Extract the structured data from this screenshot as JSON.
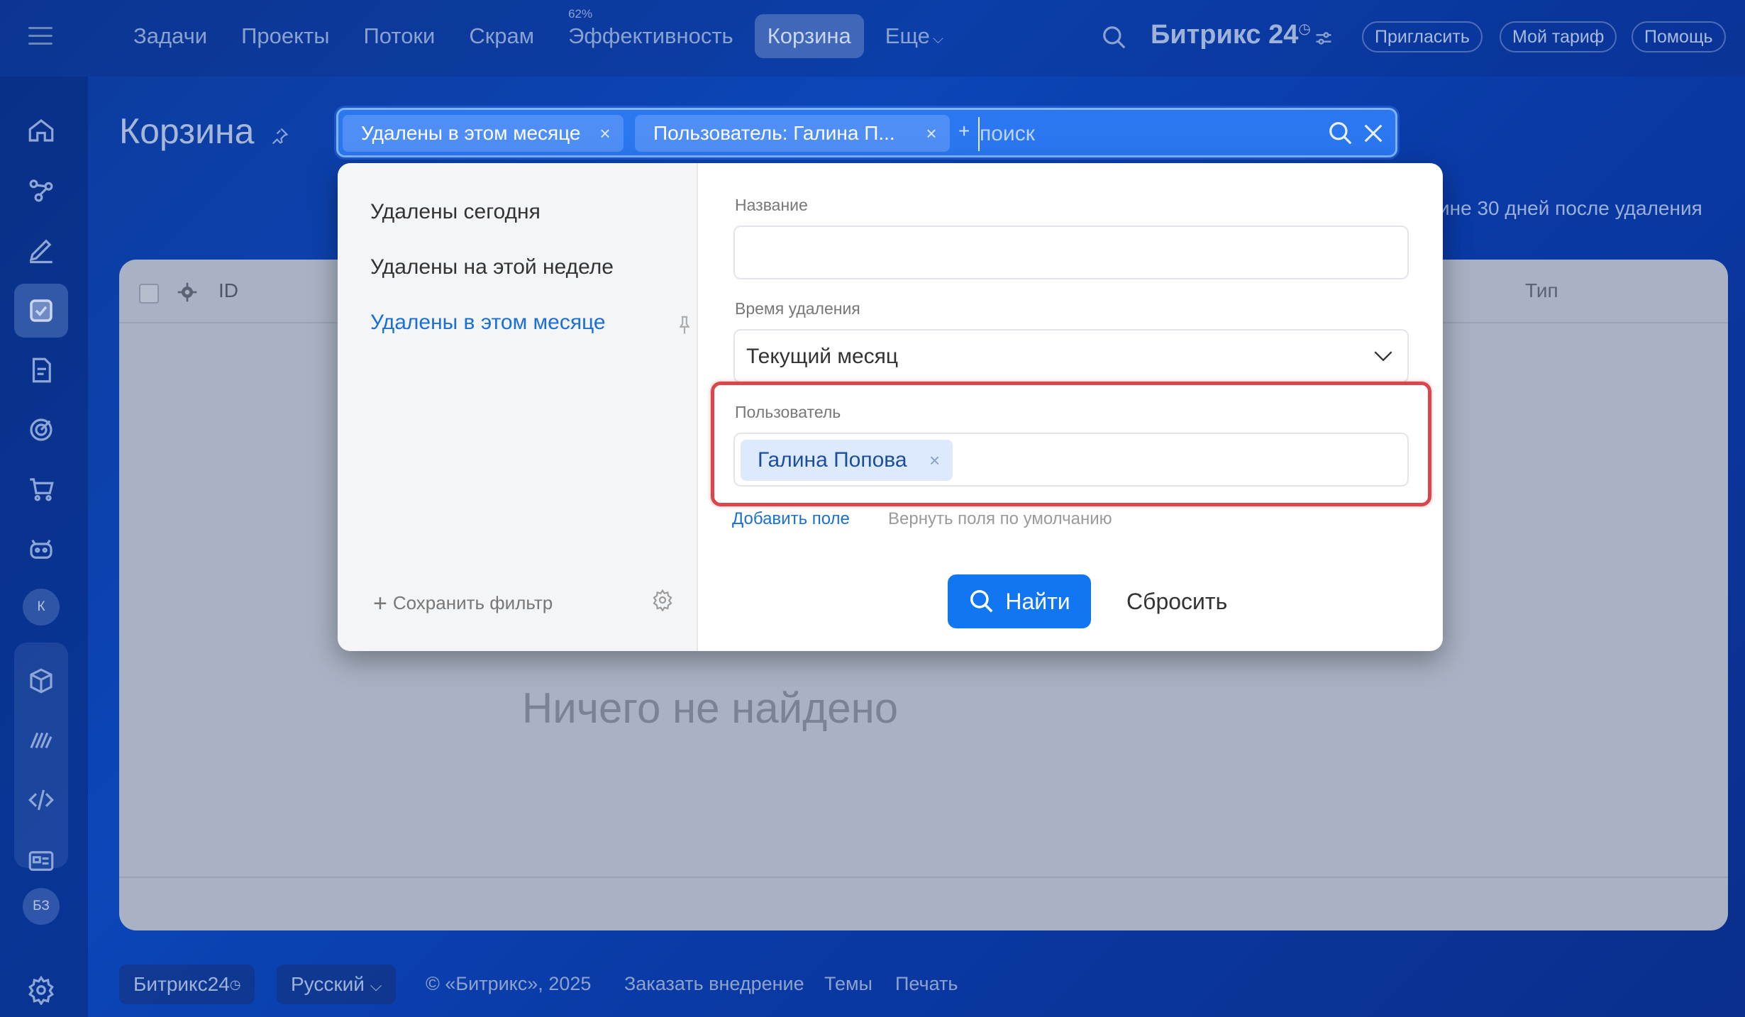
{
  "topbar": {
    "nav": [
      {
        "label": "Задачи"
      },
      {
        "label": "Проекты"
      },
      {
        "label": "Потоки"
      },
      {
        "label": "Скрам"
      },
      {
        "label": "Эффективность",
        "badge": "62%"
      },
      {
        "label": "Корзина",
        "active": true
      },
      {
        "label": "Еще"
      }
    ],
    "brand": "Битрикс 24",
    "invite": "Пригласить",
    "tariff": "Мой тариф",
    "help": "Помощь"
  },
  "sidebar": {
    "icons": [
      "home-icon",
      "flow-icon",
      "pen-icon",
      "tasks-icon",
      "document-icon",
      "target-icon",
      "cart-icon",
      "robot-icon",
      "box-icon",
      "signature-icon",
      "code-icon",
      "card-icon",
      "settings-icon"
    ],
    "avatar_k": "К",
    "avatar_bz": "БЗ"
  },
  "page": {
    "title": "Корзина",
    "retention_note": "ине 30 дней после удаления"
  },
  "search": {
    "chips": [
      "Удалены в этом месяце",
      "Пользователь: Галина П..."
    ],
    "plus": "+",
    "placeholder": "поиск"
  },
  "filter": {
    "presets": [
      {
        "label": "Удалены сегодня"
      },
      {
        "label": "Удалены на этой неделе"
      },
      {
        "label": "Удалены в этом месяце",
        "active": true
      }
    ],
    "save_filter": "Сохранить фильтр",
    "name_label": "Название",
    "name_value": "",
    "time_label": "Время удаления",
    "time_value": "Текущий месяц",
    "user_label": "Пользователь",
    "user_value": "Галина Попова",
    "add_field": "Добавить поле",
    "reset_fields": "Вернуть поля по умолчанию",
    "find": "Найти",
    "reset": "Сбросить"
  },
  "grid": {
    "col_id": "ID",
    "col_type": "Тип",
    "empty": "Ничего не найдено"
  },
  "footer": {
    "bitrix": "Битрикс24",
    "language": "Русский",
    "copyright": "© «Битрикс», 2025",
    "order": "Заказать внедрение",
    "themes": "Темы",
    "print": "Печать"
  },
  "colors": {
    "accent": "#1176f2",
    "search_bg": "#2b77f0",
    "highlight": "#d9474c",
    "active_preset": "#1a6fd8"
  }
}
